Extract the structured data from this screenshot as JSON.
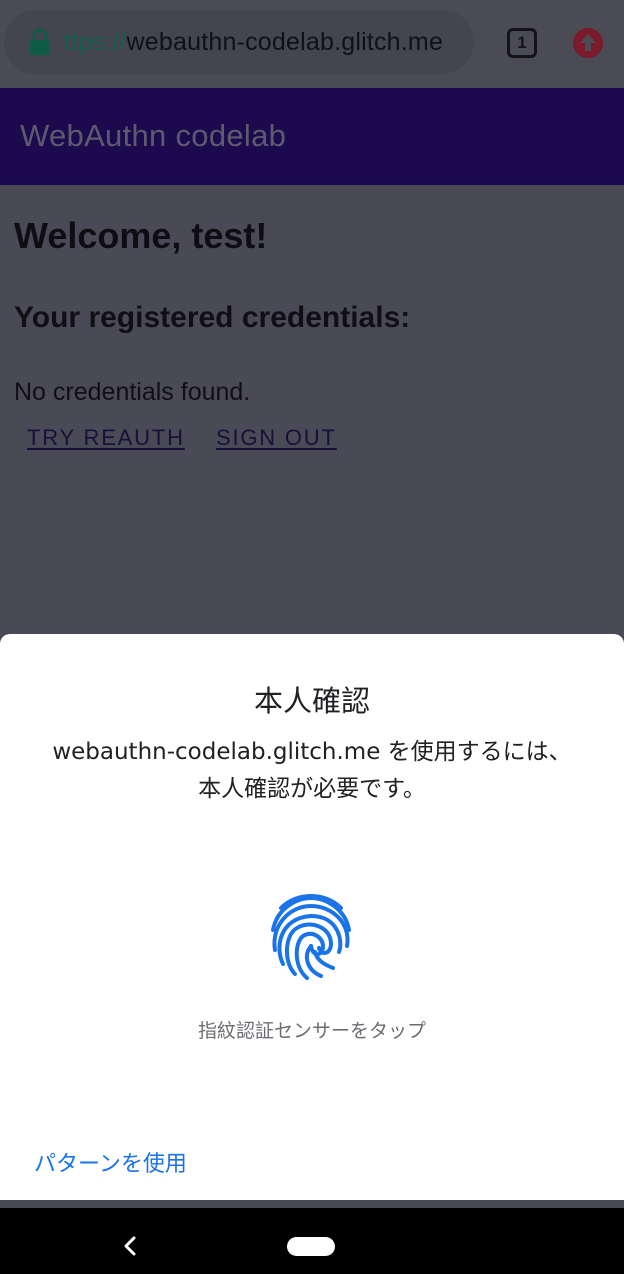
{
  "browser": {
    "url_scheme_visible": "ttps://",
    "url_host": "webauthn-codelab.glitch.me",
    "tab_count": "1",
    "icons": {
      "lock": "lock-icon",
      "update": "update-arrow-icon"
    }
  },
  "app": {
    "title": "WebAuthn codelab",
    "header_color": "#1c0a4e"
  },
  "page": {
    "welcome": "Welcome, test!",
    "credentials_heading": "Your registered credentials:",
    "no_credentials": "No credentials found.",
    "links": {
      "try_reauth": "TRY REAUTH",
      "sign_out": "SIGN OUT"
    }
  },
  "dialog": {
    "title": "本人確認",
    "description_line1": "webauthn-codelab.glitch.me を使用するには、",
    "description_line2": "本人確認が必要です。",
    "sensor_hint": "指紋認証センサーをタップ",
    "use_pattern": "パターンを使用",
    "accent_color": "#1a73e8",
    "icon": "fingerprint-icon"
  },
  "nav": {
    "icons": {
      "back": "back-icon",
      "home": "home-pill"
    }
  }
}
